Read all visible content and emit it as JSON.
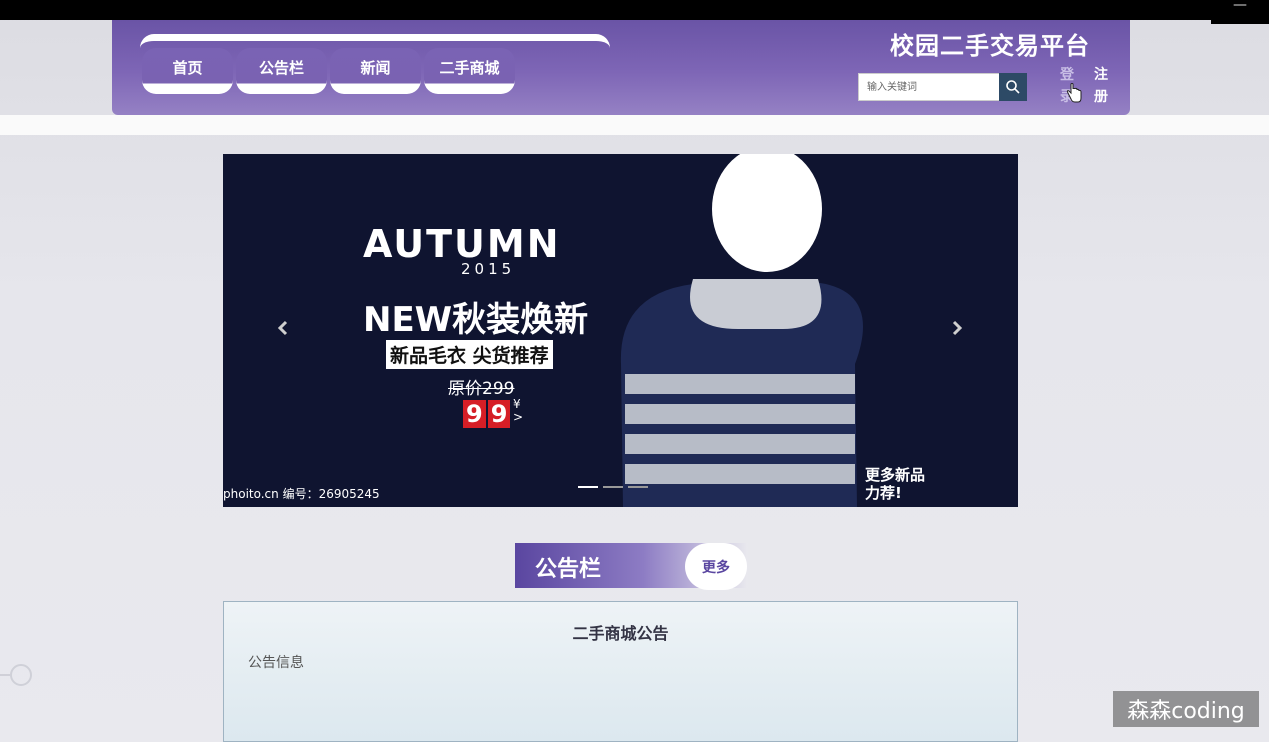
{
  "window": {
    "minimize_label": "—"
  },
  "header": {
    "site_title": "校园二手交易平台",
    "nav": [
      {
        "label": "首页"
      },
      {
        "label": "公告栏"
      },
      {
        "label": "新闻"
      },
      {
        "label": "二手商城"
      }
    ],
    "search": {
      "placeholder": "输入关键词",
      "icon": "search-icon"
    },
    "login_label": "登录",
    "register_label": "注册"
  },
  "banner": {
    "headline": "AUTUMN",
    "year": "2015",
    "subhead": "NEW秋装焕新",
    "tagline": "新品毛衣 尖货推荐",
    "original_price": "原价299",
    "price_digits": [
      "9",
      "9"
    ],
    "currency": "¥",
    "currency_arrow": ">",
    "watermark": "phoito.cn 编号：26905245",
    "more_text_line1": "更多新品",
    "more_text_line2": "力荐!",
    "prev_icon": "chevron-left-icon",
    "next_icon": "chevron-right-icon",
    "slide_count": 3,
    "active_slide": 1
  },
  "notice": {
    "section_title": "公告栏",
    "more_label": "更多",
    "panel_title": "二手商城公告",
    "panel_body": "公告信息"
  },
  "overlay": {
    "corner_watermark": "森森coding"
  }
}
